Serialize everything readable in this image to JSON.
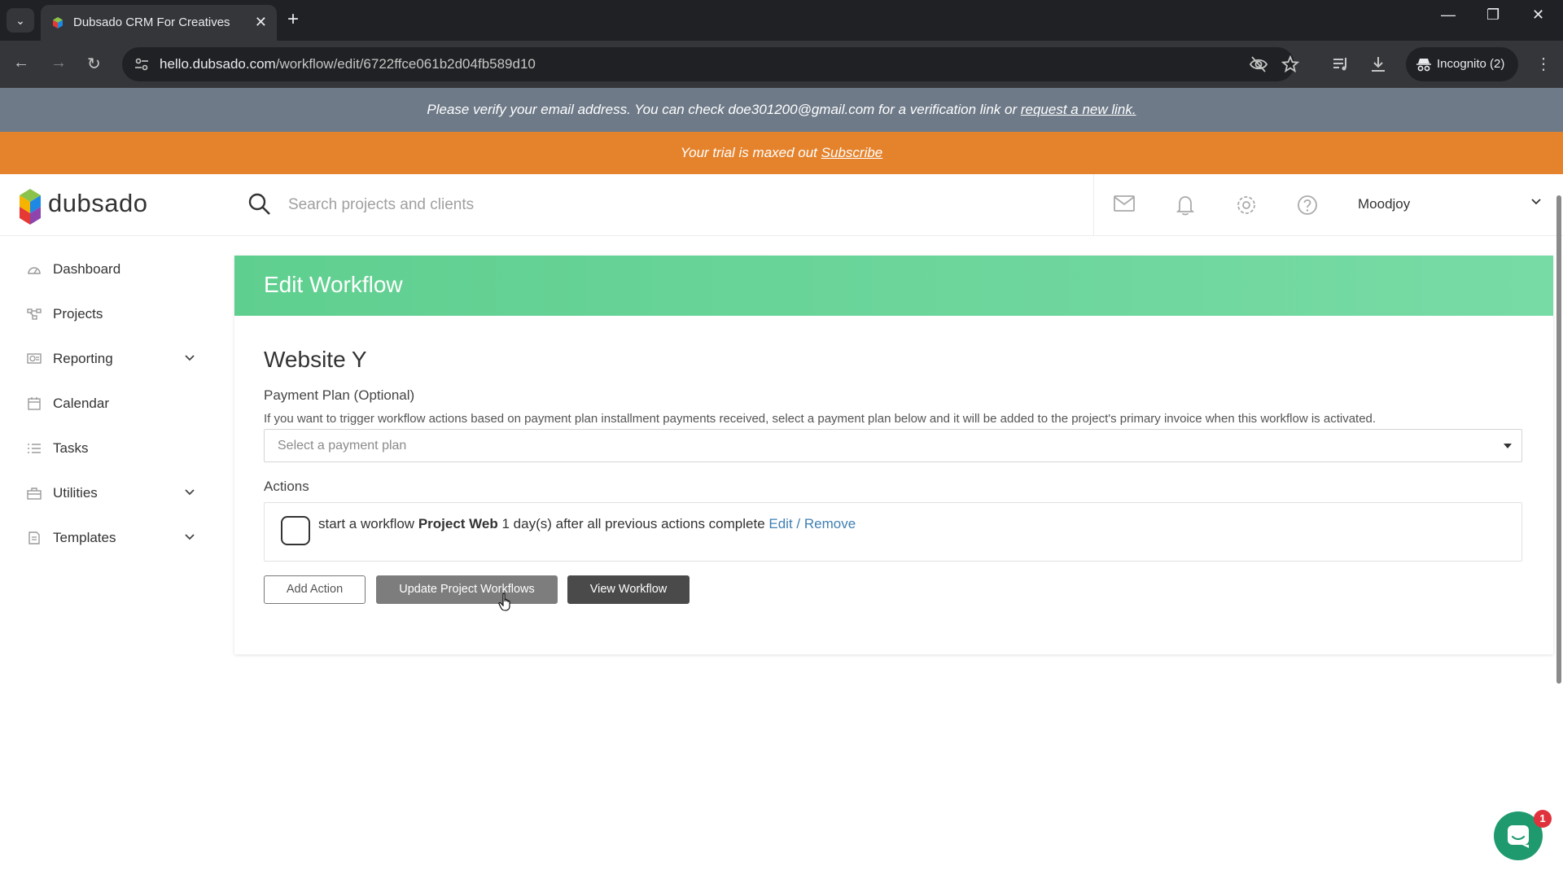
{
  "browser": {
    "tab_title": "Dubsado CRM For Creatives",
    "url_host": "hello.dubsado.com",
    "url_path": "/workflow/edit/6722ffce061b2d04fb589d10",
    "incognito_label": "Incognito (2)"
  },
  "banners": {
    "verify_text": "Please verify your email address. You can check doe301200@gmail.com for a verification link or",
    "verify_link": "request a new link.",
    "trial_text": "Your trial is maxed out",
    "trial_link": "Subscribe"
  },
  "header": {
    "logo_text": "dubsado",
    "search_placeholder": "Search projects and clients",
    "user_name": "Moodjoy"
  },
  "sidebar": {
    "items": [
      {
        "label": "Dashboard",
        "icon": "dashboard-icon",
        "expandable": false
      },
      {
        "label": "Projects",
        "icon": "projects-icon",
        "expandable": false
      },
      {
        "label": "Reporting",
        "icon": "reporting-icon",
        "expandable": true
      },
      {
        "label": "Calendar",
        "icon": "calendar-icon",
        "expandable": false
      },
      {
        "label": "Tasks",
        "icon": "tasks-icon",
        "expandable": false
      },
      {
        "label": "Utilities",
        "icon": "utilities-icon",
        "expandable": true
      },
      {
        "label": "Templates",
        "icon": "templates-icon",
        "expandable": true
      }
    ]
  },
  "main": {
    "page_title": "Edit Workflow",
    "workflow_name": "Website Y",
    "payment_plan_label": "Payment Plan (Optional)",
    "payment_plan_help": "If you want to trigger workflow actions based on payment plan installment payments received, select a payment plan below and it will be added to the project's primary invoice when this workflow is activated.",
    "payment_plan_placeholder": "Select a payment plan",
    "actions_label": "Actions",
    "action": {
      "prefix": "start a workflow",
      "workflow": "Project Web",
      "suffix": "1 day(s) after all previous actions complete",
      "edit_link": "Edit",
      "separator": "/",
      "remove_link": "Remove"
    },
    "buttons": {
      "add_action": "Add Action",
      "update_workflows": "Update Project Workflows",
      "view_workflow": "View Workflow"
    }
  },
  "chat": {
    "badge_count": "1"
  },
  "colors": {
    "header_green": "#6fd8a0",
    "trial_orange": "#e5832d",
    "verify_gray": "#6e7a88",
    "link_blue": "#3f7fb3"
  }
}
